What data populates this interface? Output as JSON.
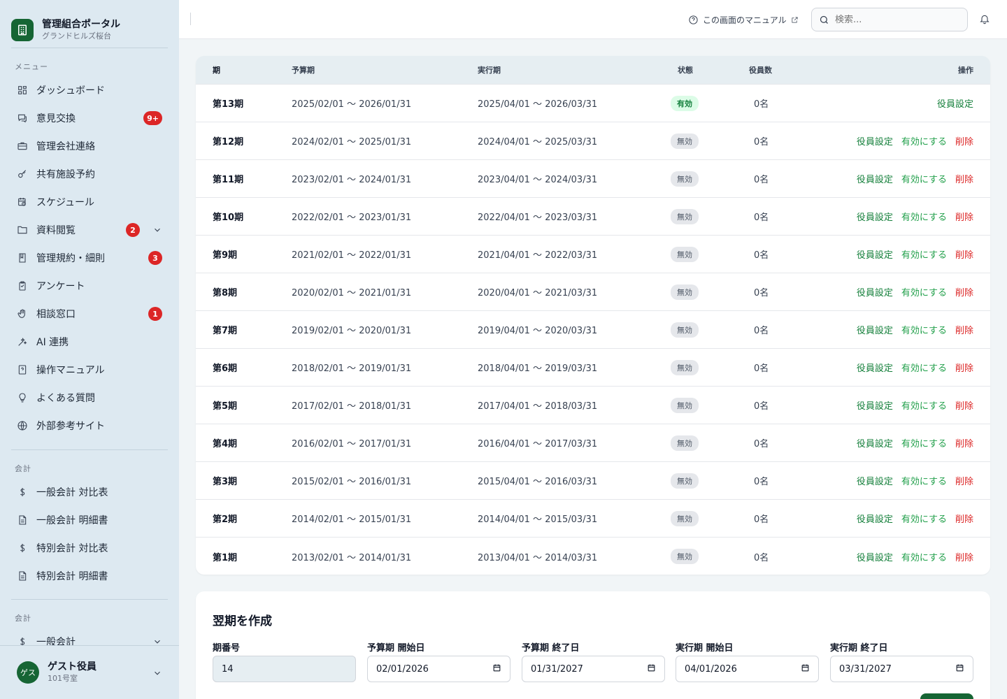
{
  "brand": {
    "title": "管理組合ポータル",
    "subtitle": "グランドヒルズ桜台"
  },
  "sidebar": {
    "menu_label": "メニュー",
    "items": [
      {
        "label": "ダッシュボード",
        "icon": "dashboard-icon"
      },
      {
        "label": "意見交換",
        "icon": "chat-icon",
        "badge": "9+"
      },
      {
        "label": "管理会社連絡",
        "icon": "briefcase-icon"
      },
      {
        "label": "共有施設予約",
        "icon": "key-icon"
      },
      {
        "label": "スケジュール",
        "icon": "calendar-clock-icon"
      },
      {
        "label": "資料閲覧",
        "icon": "folder-icon",
        "badge": "2",
        "chevron": true
      },
      {
        "label": "管理規約・細則",
        "icon": "book-icon",
        "badge": "3"
      },
      {
        "label": "アンケート",
        "icon": "clipboard-icon"
      },
      {
        "label": "相談窓口",
        "icon": "hand-icon",
        "badge": "1"
      },
      {
        "label": "AI 連携",
        "icon": "sparkle-icon"
      },
      {
        "label": "操作マニュアル",
        "icon": "manual-icon"
      },
      {
        "label": "よくある質問",
        "icon": "lightbulb-icon"
      },
      {
        "label": "外部参考サイト",
        "icon": "globe-icon"
      }
    ],
    "accounting_label": "会計",
    "accounting_items": [
      {
        "label": "一般会計 対比表",
        "icon": "dollar-icon"
      },
      {
        "label": "一般会計 明細書",
        "icon": "document-icon"
      },
      {
        "label": "特別会計 対比表",
        "icon": "dollar-icon"
      },
      {
        "label": "特別会計 明細書",
        "icon": "document-icon"
      }
    ],
    "accounting2_label": "会計",
    "accounting2_items": [
      {
        "label": "一般会計",
        "icon": "dollar-icon",
        "chevron": true
      }
    ]
  },
  "user": {
    "avatar": "ゲス",
    "name": "ゲスト役員",
    "room": "101号室"
  },
  "header": {
    "manual_link": "この画面のマニュアル",
    "search_placeholder": "検索..."
  },
  "table": {
    "headers": {
      "term": "期",
      "budget": "予算期",
      "exec": "実行期",
      "status": "状態",
      "members": "役員数",
      "actions": "操作"
    },
    "rows": [
      {
        "term": "第13期",
        "budget": "2025/02/01 〜 2026/01/31",
        "exec": "2025/04/01 〜 2026/03/31",
        "status": "有効",
        "active": true,
        "members": "0名"
      },
      {
        "term": "第12期",
        "budget": "2024/02/01 〜 2025/01/31",
        "exec": "2024/04/01 〜 2025/03/31",
        "status": "無効",
        "active": false,
        "members": "0名"
      },
      {
        "term": "第11期",
        "budget": "2023/02/01 〜 2024/01/31",
        "exec": "2023/04/01 〜 2024/03/31",
        "status": "無効",
        "active": false,
        "members": "0名"
      },
      {
        "term": "第10期",
        "budget": "2022/02/01 〜 2023/01/31",
        "exec": "2022/04/01 〜 2023/03/31",
        "status": "無効",
        "active": false,
        "members": "0名"
      },
      {
        "term": "第9期",
        "budget": "2021/02/01 〜 2022/01/31",
        "exec": "2021/04/01 〜 2022/03/31",
        "status": "無効",
        "active": false,
        "members": "0名"
      },
      {
        "term": "第8期",
        "budget": "2020/02/01 〜 2021/01/31",
        "exec": "2020/04/01 〜 2021/03/31",
        "status": "無効",
        "active": false,
        "members": "0名"
      },
      {
        "term": "第7期",
        "budget": "2019/02/01 〜 2020/01/31",
        "exec": "2019/04/01 〜 2020/03/31",
        "status": "無効",
        "active": false,
        "members": "0名"
      },
      {
        "term": "第6期",
        "budget": "2018/02/01 〜 2019/01/31",
        "exec": "2018/04/01 〜 2019/03/31",
        "status": "無効",
        "active": false,
        "members": "0名"
      },
      {
        "term": "第5期",
        "budget": "2017/02/01 〜 2018/01/31",
        "exec": "2017/04/01 〜 2018/03/31",
        "status": "無効",
        "active": false,
        "members": "0名"
      },
      {
        "term": "第4期",
        "budget": "2016/02/01 〜 2017/01/31",
        "exec": "2016/04/01 〜 2017/03/31",
        "status": "無効",
        "active": false,
        "members": "0名"
      },
      {
        "term": "第3期",
        "budget": "2015/02/01 〜 2016/01/31",
        "exec": "2015/04/01 〜 2016/03/31",
        "status": "無効",
        "active": false,
        "members": "0名"
      },
      {
        "term": "第2期",
        "budget": "2014/02/01 〜 2015/01/31",
        "exec": "2014/04/01 〜 2015/03/31",
        "status": "無効",
        "active": false,
        "members": "0名"
      },
      {
        "term": "第1期",
        "budget": "2013/02/01 〜 2014/01/31",
        "exec": "2013/04/01 〜 2014/03/31",
        "status": "無効",
        "active": false,
        "members": "0名"
      }
    ],
    "action_labels": {
      "officers": "役員設定",
      "activate": "有効にする",
      "delete": "削除"
    }
  },
  "create": {
    "title": "翌期を作成",
    "fields": [
      {
        "label": "期番号",
        "value": "14",
        "readonly": true
      },
      {
        "label": "予算期 開始日",
        "value": "02/01/2026"
      },
      {
        "label": "予算期 終了日",
        "value": "01/31/2027"
      },
      {
        "label": "実行期 開始日",
        "value": "04/01/2026"
      },
      {
        "label": "実行期 終了日",
        "value": "03/31/2027"
      }
    ]
  },
  "colors": {
    "brand": "#166534",
    "sidebar": "#dde9f1",
    "danger": "#dc2626",
    "action_green": "#16803c"
  }
}
